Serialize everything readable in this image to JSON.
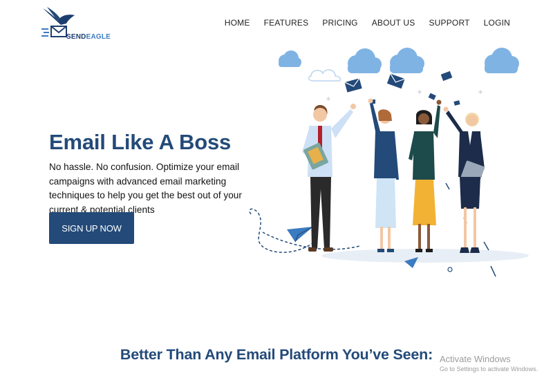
{
  "brand": {
    "name_part1": "SEND",
    "name_part2": "EAGLE"
  },
  "nav": {
    "items": [
      {
        "label": "HOME"
      },
      {
        "label": "FEATURES"
      },
      {
        "label": "PRICING"
      },
      {
        "label": "ABOUT US"
      },
      {
        "label": "SUPPORT"
      },
      {
        "label": "LOGIN"
      }
    ]
  },
  "hero": {
    "title": "Email Like A Boss",
    "subtitle": "No hassle. No confusion. Optimize your email campaigns with advanced email marketing techniques to help you get the best out of your current & potential clients",
    "cta_label": "SIGN UP NOW"
  },
  "section": {
    "title": "Better Than Any Email Platform You’ve Seen:"
  },
  "watermark": {
    "title": "Activate Windows",
    "subtitle": "Go to Settings to activate Windows."
  },
  "colors": {
    "primary": "#234a79",
    "accent": "#3b7bc0",
    "cloud": "#7fb3e3",
    "shirt_yellow": "#f2b233"
  },
  "icons": {
    "logo": "eagle-envelope-icon",
    "envelope": "envelope-icon",
    "paper_plane": "paper-plane-icon",
    "cloud": "cloud-icon"
  }
}
